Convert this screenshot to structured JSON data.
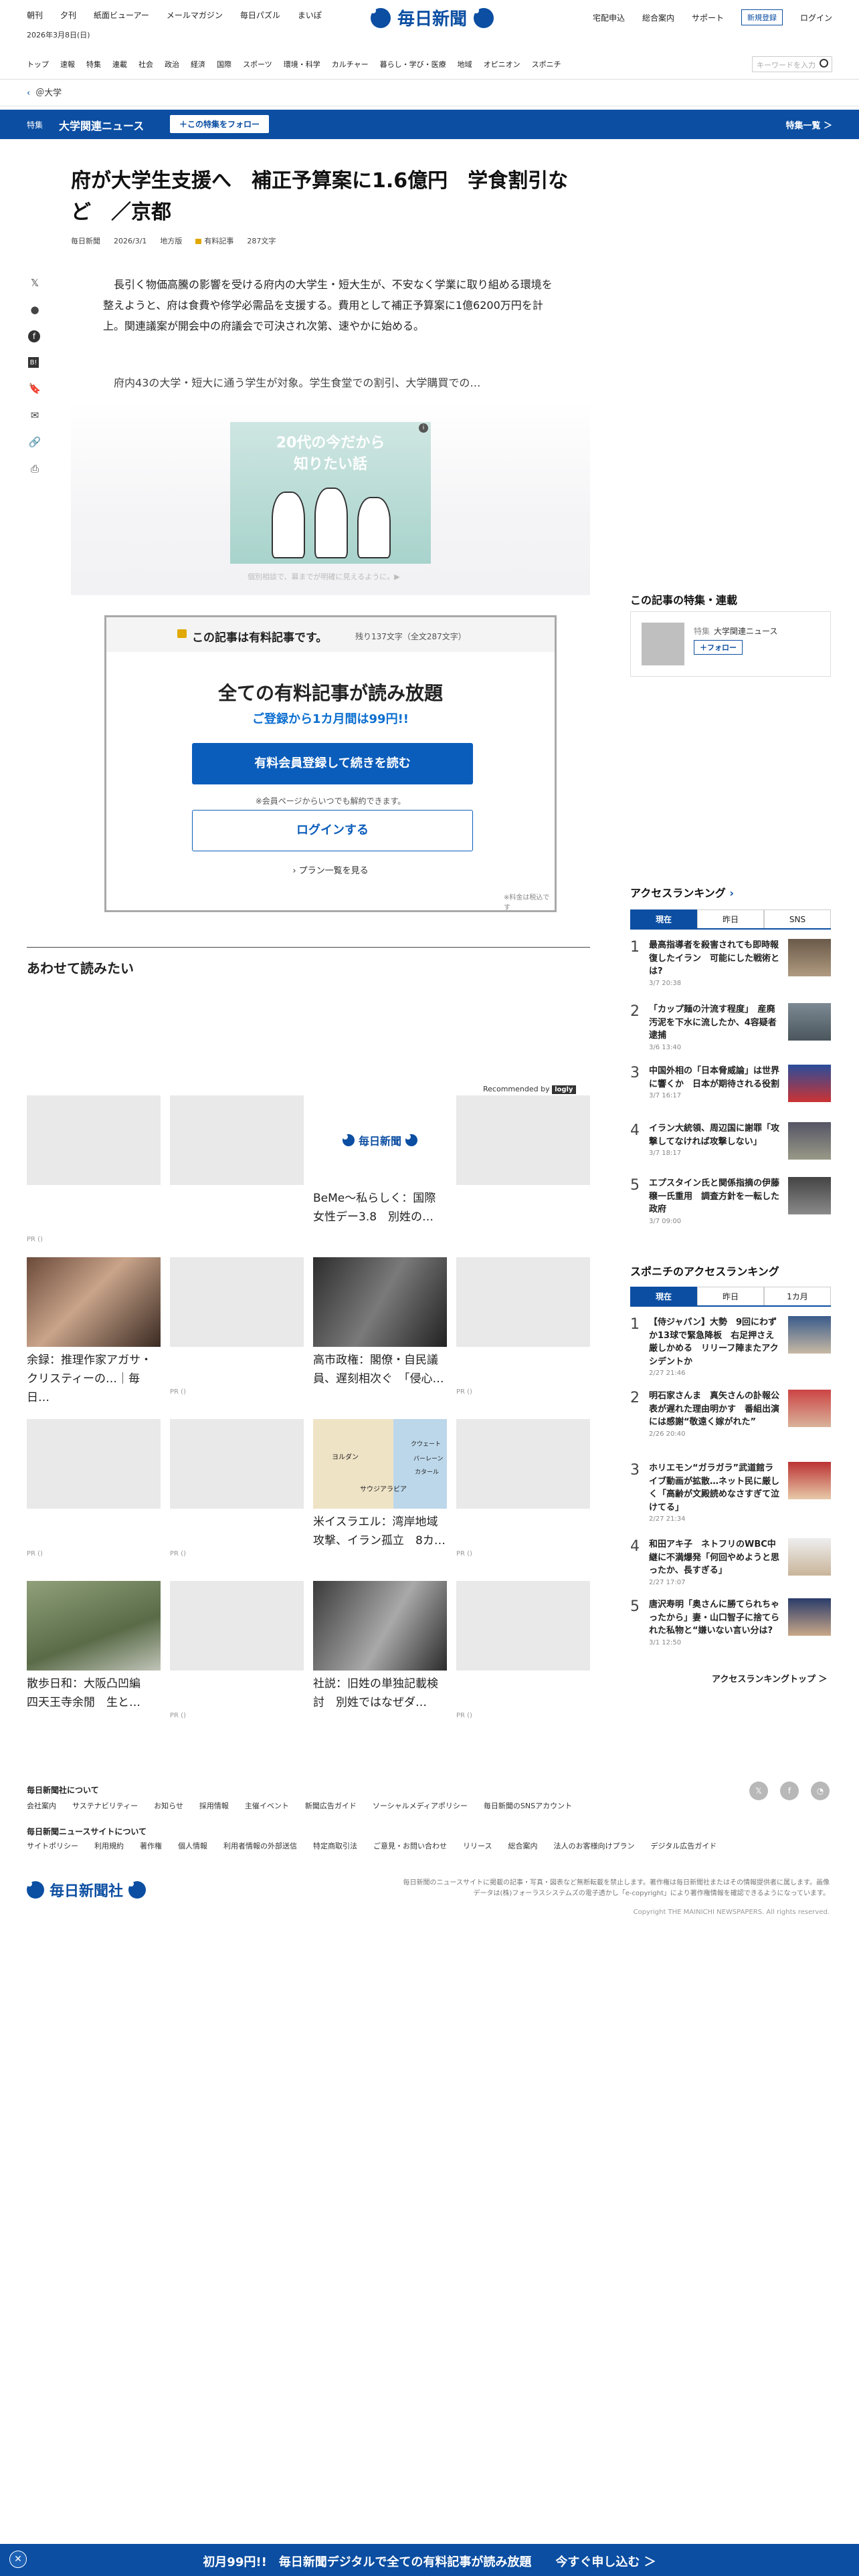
{
  "header": {
    "topnav": [
      "朝刊",
      "夕刊",
      "紙面ビューアー",
      "メールマガジン",
      "毎日パズル",
      "まいぽ"
    ],
    "date": "2026年3月8日(日)",
    "logo": "毎日新聞",
    "right_links": [
      "宅配申込",
      "総合案内",
      "サポート"
    ],
    "register": "新規登録",
    "login": "ログイン",
    "categories": [
      "トップ",
      "速報",
      "特集",
      "連載",
      "社会",
      "政治",
      "経済",
      "国際",
      "スポーツ",
      "環境・科学",
      "カルチャー",
      "暮らし・学び・医療",
      "地域",
      "オピニオン",
      "スポニチ"
    ],
    "search_placeholder": "キーワードを入力",
    "breadcrumb": "＠大学"
  },
  "feature_bar": {
    "tag": "特集",
    "title": "大学関連ニュース",
    "follow": "＋この特集をフォロー",
    "list": "特集一覧 ＞"
  },
  "article": {
    "headline": "府が大学生支援へ　補正予算案に1.6億円　学食割引など　／京都",
    "source": "毎日新聞",
    "date": "2026/3/1",
    "edition": "地方版",
    "paid": "有料記事",
    "chars": "287文字",
    "lead": "長引く物価高騰の影響を受ける府内の大学生・短大生が、不安なく学業に取り組める環境を整えようと、府は食費や修学必需品を支援する。費用として補正予算案に1億6200万円を計上。関連議案が開会中の府議会で可決され次第、速やかに始める。",
    "body": "府内43の大学・短大に通う学生が対象。学生食堂での割引、大学購買での…",
    "ad_text": "20代の今だから\n知りたい話",
    "ad_caption": "個別相談で、幕までが明確に見えるように。▶"
  },
  "paywall": {
    "title": "この記事は有料記事です。",
    "remaining": "残り137文字（全文287文字）",
    "headline": "全ての有料記事が読み放題",
    "sub": "ご登録から1カ月間は99円!!",
    "cta": "有料会員登録して続きを読む",
    "note": "※会員ページからいつでも解約できます。",
    "login": "ログインする",
    "plans": "プラン一覧を見る",
    "tax": "※料金は税込です"
  },
  "read_also": {
    "title": "あわせて読みたい",
    "rec_by": "Recommended by",
    "rec_brand": "logly",
    "cards": [
      {
        "title": "",
        "pr": "PR ()"
      },
      {
        "title": "",
        "pr": ""
      },
      {
        "title": "BeMe〜私らしく：国際女性デー3.8　別姓の…",
        "pr": ""
      },
      {
        "title": "",
        "pr": ""
      },
      {
        "title": "余録：推理作家アガサ・クリスティーの…｜毎日…",
        "pr": ""
      },
      {
        "title": "",
        "pr": "PR ()"
      },
      {
        "title": "高市政権：閣僚・自民議員、遅刻相次ぐ　「侵心…",
        "pr": ""
      },
      {
        "title": "",
        "pr": "PR ()"
      },
      {
        "title": "",
        "pr": "PR ()"
      },
      {
        "title": "",
        "pr": "PR ()"
      },
      {
        "title": "米イスラエル：湾岸地域攻撃、イラン孤立　8カ…",
        "pr": ""
      },
      {
        "title": "",
        "pr": "PR ()"
      },
      {
        "title": "散歩日和：大阪凸凹編　四天王寺余閒　生と…",
        "pr": ""
      },
      {
        "title": "",
        "pr": "PR ()"
      },
      {
        "title": "社説：旧姓の単独記載検討　別姓ではなぜダ…",
        "pr": ""
      },
      {
        "title": "",
        "pr": "PR ()"
      }
    ],
    "map_labels": [
      "ヨルダン",
      "サウジアラビア",
      "クウェート",
      "バーレーン",
      "カタール"
    ]
  },
  "sidebar": {
    "feature_heading": "この記事の特集・連載",
    "feature_tag": "特集",
    "feature_title": "大学関連ニュース",
    "feature_follow": "＋フォロー",
    "ranking_heading": "アクセスランキング",
    "ranking_tabs": [
      "現在",
      "昨日",
      "SNS"
    ],
    "ranking": [
      {
        "num": "1",
        "title": "最高指導者を殺害されても即時報復したイラン　可能にした戦術とは?",
        "date": "3/7 20:38"
      },
      {
        "num": "2",
        "title": "「カップ麺の汁流す程度」　産廃汚泥を下水に流したか、4容疑者逮捕",
        "date": "3/6 13:40"
      },
      {
        "num": "3",
        "title": "中国外相の「日本脅威論」は世界に響くか　日本が期待される役割",
        "date": "3/7 16:17"
      },
      {
        "num": "4",
        "title": "イラン大統領、周辺国に謝罪「攻撃してなければ攻撃しない」",
        "date": "3/7 18:17"
      },
      {
        "num": "5",
        "title": "エプスタイン氏と関係指摘の伊藤穣一氏重用　調査方針を一転した政府",
        "date": "3/7 09:00"
      }
    ],
    "sponichi_heading": "スポニチのアクセスランキング",
    "sponichi_tabs": [
      "現在",
      "昨日",
      "1カ月"
    ],
    "sponichi": [
      {
        "num": "1",
        "title": "【侍ジャパン】大勢　9回にわずか13球で緊急降板　右足押さえ厳しかめる　リリーフ陣またアクシデントか",
        "date": "2/27 21:46"
      },
      {
        "num": "2",
        "title": "明石家さんま　真矢さんの訃報公表が遅れた理由明かす　番組出演には感謝“敬遠く嫁がれた”",
        "date": "2/26 20:40"
      },
      {
        "num": "3",
        "title": "ホリエモン“ガラガラ”武道館ライブ動画が拡散…ネット民に厳しく「高齢が文殿読めなさすぎて泣けてる」",
        "date": "2/27 21:34"
      },
      {
        "num": "4",
        "title": "和田アキ子　ネトフリのWBC中継に不満爆発「何回やめようと思ったか、長すぎる」",
        "date": "2/27 17:07"
      },
      {
        "num": "5",
        "title": "唐沢寿明「奥さんに勝てられちゃったから」妻・山口智子に捨てられた私物と“嫌いない言い分は?",
        "date": "3/1 12:50"
      }
    ],
    "ranking_top": "アクセスランキングトップ ＞"
  },
  "footer": {
    "about_heading": "毎日新聞社について",
    "about_links": [
      "会社案内",
      "サステナビリティー",
      "お知らせ",
      "採用情報",
      "主催イベント",
      "新聞広告ガイド",
      "ソーシャルメディアポリシー",
      "毎日新聞のSNSアカウント"
    ],
    "site_heading": "毎日新聞ニュースサイトについて",
    "site_links": [
      "サイトポリシー",
      "利用規約",
      "著作権",
      "個人情報",
      "利用者情報の外部送信",
      "特定商取引法",
      "ご意見・お問い合わせ",
      "リリース",
      "総合案内",
      "法人のお客様向けプラン",
      "デジタル広告ガイド"
    ],
    "logo": "毎日新聞社",
    "note": "毎日新聞のニュースサイトに掲載の記事・写真・図表など無断転載を禁止します。著作権は毎日新聞社またはその情報提供者に属します。画像データは(株)フォーラスシステムズの電子透かし「e-copyright」により著作権情報を確認できるようになっています。",
    "copyright": "Copyright THE MAINICHI NEWSPAPERS. All rights reserved."
  },
  "banner": {
    "text": "初月99円!!　毎日新聞デジタルで全ての有料記事が読み放題　　今すぐ申し込む ＞"
  }
}
